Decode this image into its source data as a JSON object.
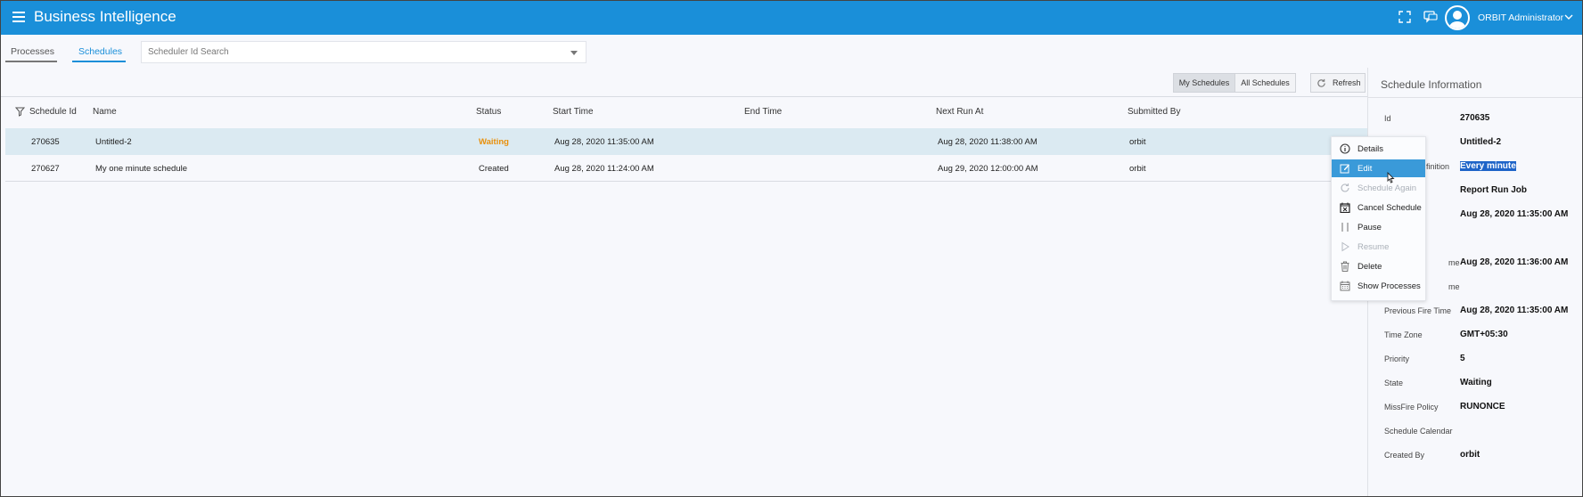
{
  "header": {
    "title": "Business Intelligence",
    "user_name": "ORBIT Administrator",
    "icons": [
      "menu-icon",
      "fullscreen-icon",
      "chat-icon",
      "avatar-icon",
      "chevron-down-icon"
    ],
    "bar_color": "#1a8fd9"
  },
  "tabs": [
    {
      "label": "Processes",
      "active": false
    },
    {
      "label": "Schedules",
      "active": true
    }
  ],
  "search": {
    "placeholder": "Scheduler Id Search"
  },
  "toolbar": {
    "my_schedules": "My Schedules",
    "all_schedules": "All Schedules",
    "refresh": "Refresh"
  },
  "table": {
    "columns": [
      "Schedule Id",
      "Name",
      "Status",
      "Start Time",
      "End Time",
      "Next Run At",
      "Submitted By"
    ],
    "rows": [
      {
        "id": "270635",
        "name": "Untitled-2",
        "status": "Waiting",
        "start": "Aug 28, 2020 11:35:00 AM",
        "end": "",
        "next": "Aug 28, 2020 11:38:00 AM",
        "by": "orbit",
        "selected": true
      },
      {
        "id": "270627",
        "name": "My one minute schedule",
        "status": "Created",
        "start": "Aug 28, 2020 11:24:00 AM",
        "end": "",
        "next": "Aug 29, 2020 12:00:00 AM",
        "by": "orbit",
        "selected": false
      }
    ]
  },
  "info": {
    "title": "Schedule Information",
    "fields": [
      {
        "label": "Id",
        "value": "270635"
      },
      {
        "label": "",
        "value": "Untitled-2"
      },
      {
        "label": "efinition",
        "value": "Every minute",
        "highlight": true
      },
      {
        "label": "",
        "value": "Report Run Job"
      },
      {
        "label": "",
        "value": "Aug 28, 2020 11:35:00 AM"
      },
      {
        "label": "me",
        "value": "Aug 28, 2020 11:36:00 AM"
      },
      {
        "label": "me",
        "value": ""
      },
      {
        "label": "Previous Fire Time",
        "value": "Aug 28, 2020 11:35:00 AM"
      },
      {
        "label": "Time Zone",
        "value": "GMT+05:30"
      },
      {
        "label": "Priority",
        "value": "5"
      },
      {
        "label": "State",
        "value": "Waiting"
      },
      {
        "label": "MissFire Policy",
        "value": "RUNONCE"
      },
      {
        "label": "Schedule Calendar",
        "value": ""
      },
      {
        "label": "Created By",
        "value": "orbit"
      }
    ]
  },
  "context_menu": {
    "items": [
      {
        "label": "Details",
        "icon": "info-icon",
        "enabled": true
      },
      {
        "label": "Edit",
        "icon": "edit-icon",
        "enabled": true,
        "active": true
      },
      {
        "label": "Schedule Again",
        "icon": "redo-icon",
        "enabled": false
      },
      {
        "label": "Cancel Schedule",
        "icon": "cancel-calendar-icon",
        "enabled": true
      },
      {
        "label": "Pause",
        "icon": "pause-icon",
        "enabled": true
      },
      {
        "label": "Resume",
        "icon": "play-icon",
        "enabled": false
      },
      {
        "label": "Delete",
        "icon": "trash-icon",
        "enabled": true
      },
      {
        "label": "Show Processes",
        "icon": "calendar-icon",
        "enabled": true
      }
    ]
  },
  "colors": {
    "accent": "#1a8fd9",
    "waiting": "#e8900c",
    "selected_row": "#dbeaf2",
    "menu_active": "#3a9ad9"
  }
}
